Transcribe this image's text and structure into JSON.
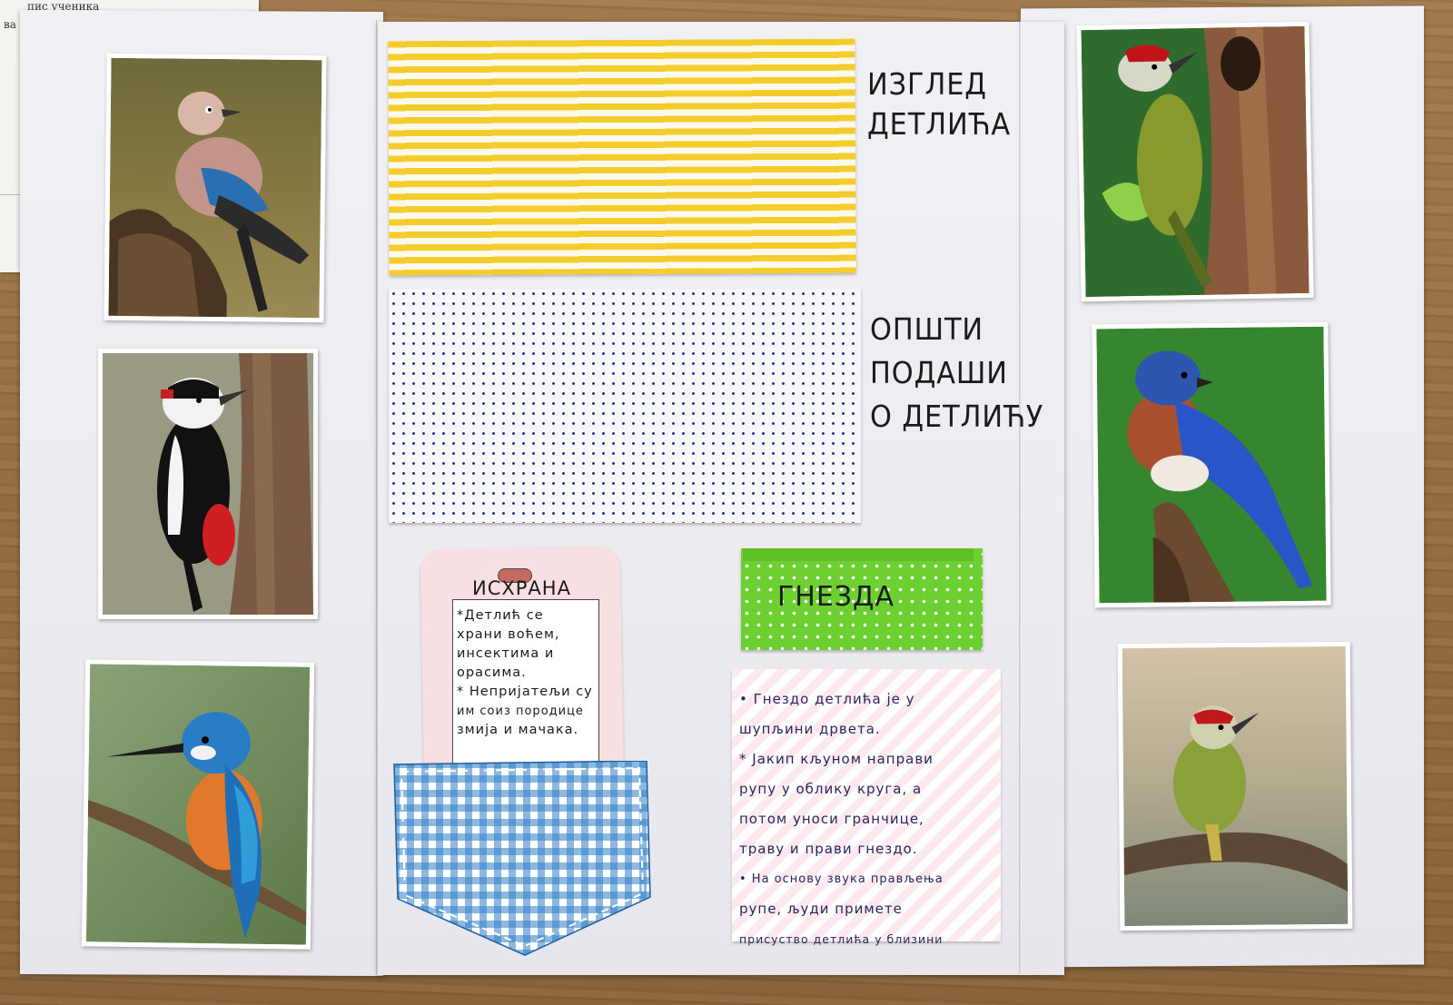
{
  "background_paper": {
    "line1": "пис ученика",
    "line2": "ва мал"
  },
  "panels": {
    "middle": {
      "flap_appearance_label_1": "ИЗГЛЕД",
      "flap_appearance_label_2": "ДЕТЛИЋА",
      "flap_general_label_1": "ОПШТИ",
      "flap_general_label_2": "ПОДАШИ",
      "flap_general_label_3": "О ДЕТЛИЋУ",
      "nests_flap_title": "ГНЕЗДА",
      "food_card": {
        "title": "ИСХРАНА",
        "lines": [
          "*Детлић се",
          "храни воћем,",
          "инсектима и",
          "орасима.",
          "* Непријатељи су",
          "им соиз породице",
          "змија и мачака."
        ]
      },
      "nest_note": {
        "lines": [
          "• Гнездо детлића је у",
          "шупљини дрвета.",
          "* Јакип кљуном направи",
          "рупу у облику круга, а",
          "потом уноси гранчице,",
          "траву и прави гнездо.",
          "• На основу звука прављења",
          "рупе, људи примете",
          "присуство детлића у близини"
        ]
      }
    }
  },
  "photos": {
    "left": [
      "jay-bird-photo",
      "great-spotted-woodpecker-photo",
      "kingfisher-photo"
    ],
    "right": [
      "green-woodpecker-at-nest-hole-photo",
      "eastern-bluebird-photo",
      "green-woodpecker-on-branch-photo"
    ]
  },
  "colors": {
    "yellow_stripe": "#f4cd2d",
    "navy_dot": "#1e2f8a",
    "green_flap": "#6cd030",
    "pink_card": "#f8dfe2",
    "gingham_blue": "#2f7fc6",
    "note_ink": "#2a2560"
  }
}
